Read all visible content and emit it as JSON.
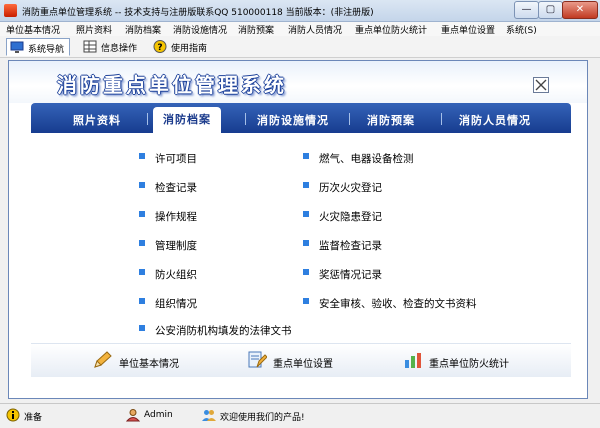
{
  "window": {
    "title": "消防重点单位管理系统 -- 技术支持与注册版联系QQ 510000118    当前版本：(非注册版)",
    "min_glyph": "—",
    "max_glyph": "▢",
    "close_glyph": "✕"
  },
  "menu": [
    "单位基本情况",
    "照片资料",
    "消防档案",
    "消防设施情况",
    "消防预案",
    "消防人员情况",
    "重点单位防火统计",
    "重点单位设置",
    "系统(S)"
  ],
  "toolbar": [
    {
      "label": "系统导航",
      "icon": "monitor-icon"
    },
    {
      "label": "信息操作",
      "icon": "grid-icon"
    },
    {
      "label": "使用指南",
      "icon": "help-icon"
    }
  ],
  "header": {
    "app_title": "消防重点单位管理系统",
    "close_glyph": "✕"
  },
  "tabs": [
    {
      "label": "照片资料",
      "active": false
    },
    {
      "label": "消防档案",
      "active": true
    },
    {
      "label": "消防设施情况",
      "active": false
    },
    {
      "label": "消防预案",
      "active": false
    },
    {
      "label": "消防人员情况",
      "active": false
    }
  ],
  "items_left": [
    "许可项目",
    "检查记录",
    "操作规程",
    "管理制度",
    "防火组织",
    "组织情况",
    "公安消防机构填发的法律文书"
  ],
  "items_right": [
    "燃气、电器设备检测",
    "历次火灾登记",
    "火灾隐患登记",
    "监督检查记录",
    "奖惩情况记录",
    "安全审核、验收、检查的文书资料"
  ],
  "quick_links": [
    {
      "label": "单位基本情况",
      "icon": "pencil-icon"
    },
    {
      "label": "重点单位设置",
      "icon": "settings-doc-icon"
    },
    {
      "label": "重点单位防火统计",
      "icon": "chart-icon"
    }
  ],
  "status": [
    {
      "text": "准备",
      "icon": "info-icon"
    },
    {
      "text": "Admin",
      "icon": "user-icon"
    },
    {
      "text": "欢迎使用我们的产品!",
      "icon": "users-icon"
    }
  ],
  "colors": {
    "accent": "#1b3b8c",
    "bullet": "#2e7fe0"
  }
}
